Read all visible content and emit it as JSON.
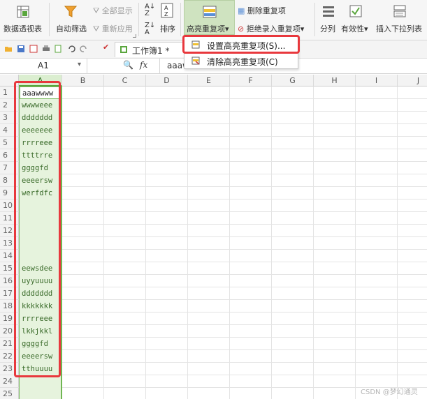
{
  "ribbon": {
    "pivot_table": "数据透视表",
    "auto_filter": "自动筛选",
    "show_all": "全部显示",
    "reapply": "重新应用",
    "sort": "排序",
    "highlight_duplicates": "高亮重复项",
    "delete_duplicates": "删除重复项",
    "reject_duplicates": "拒绝录入重复项",
    "split_column": "分列",
    "validity": "有效性",
    "insert_dropdown": "插入下拉列表"
  },
  "tab": {
    "name": "工作簿1 *"
  },
  "formula_bar": {
    "name_box": "A1",
    "fx": "fx",
    "content": "aaaw"
  },
  "menu": {
    "items": [
      {
        "label": "设置高亮重复项(S)..."
      },
      {
        "label": "清除高亮重复项(C)"
      }
    ]
  },
  "grid": {
    "columns": [
      "A",
      "B",
      "C",
      "D",
      "E",
      "F",
      "G",
      "H",
      "I",
      "J"
    ],
    "rows": [
      "1",
      "2",
      "3",
      "4",
      "5",
      "6",
      "7",
      "8",
      "9",
      "10",
      "11",
      "12",
      "13",
      "14",
      "15",
      "16",
      "17",
      "18",
      "19",
      "20",
      "21",
      "22",
      "23",
      "24",
      "25"
    ],
    "column_a": [
      "aaawwww",
      "wwwweee",
      "ddddddd",
      "eeeeeee",
      "rrrreee",
      "ttttrre",
      "ggggfd",
      "eeeersw",
      "werfdfc",
      "",
      "",
      "",
      "",
      "",
      "eewsdee",
      "uyyuuuu",
      "ddddddd",
      "kkkkkkk",
      "rrrreee",
      "lkkjkkl",
      "ggggfd",
      "eeeersw",
      "tthuuuu",
      "",
      ""
    ]
  },
  "watermark": "CSDN @梦幻通灵",
  "colors": {
    "accent_green": "#5aa63d",
    "highlight_red": "#e8383d",
    "cell_fill": "#e6f3dd"
  }
}
